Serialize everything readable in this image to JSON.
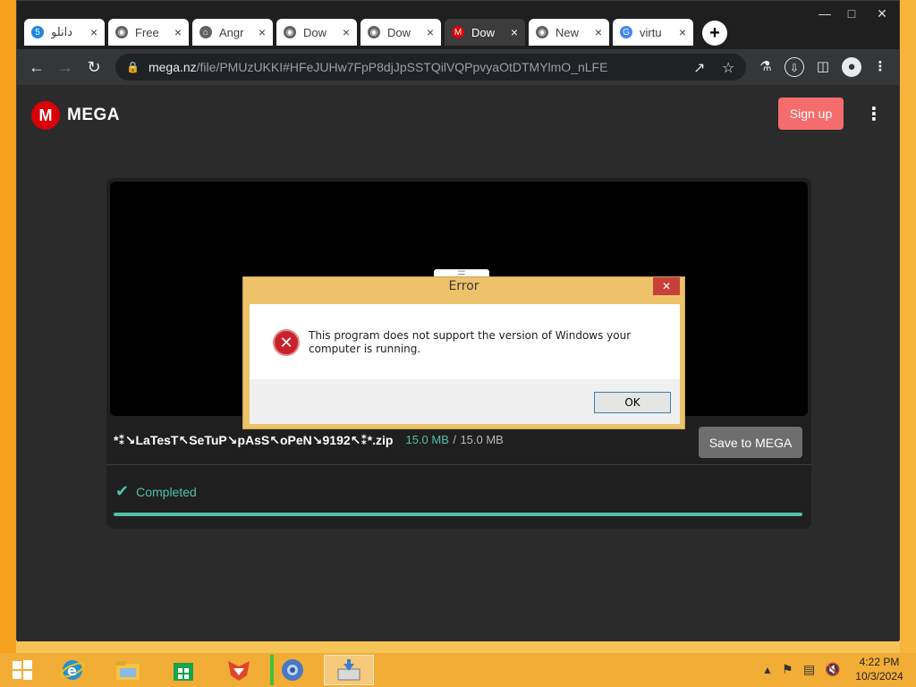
{
  "browser": {
    "tabs": [
      {
        "label": "دانلو",
        "icon": "5-site-icon",
        "icon_color": "#1e88e5"
      },
      {
        "label": "Free",
        "icon": "globe-icon",
        "icon_color": "#5f6368"
      },
      {
        "label": "Angr",
        "icon": "bank-icon",
        "icon_color": "#5f6368"
      },
      {
        "label": "Dow",
        "icon": "globe-icon",
        "icon_color": "#5f6368"
      },
      {
        "label": "Dow",
        "icon": "globe-icon",
        "icon_color": "#5f6368"
      },
      {
        "label": "Dow",
        "icon": "mega-icon",
        "icon_color": "#d90007",
        "active": true
      },
      {
        "label": "New",
        "icon": "chrome-icon",
        "icon_color": "#5f6368"
      },
      {
        "label": "virtu",
        "icon": "google-icon",
        "icon_color": "#4285f4"
      }
    ],
    "close_glyph": "×",
    "new_tab_glyph": "+",
    "url_host": "mega.nz",
    "url_path": "/file/PMUzUKKI#HFeJUHw7FpP8djJpSSTQilVQPpvyaOtDTMYlmO_nLFE"
  },
  "page": {
    "logo_letter": "M",
    "logo_word": "MEGA",
    "signup_label": "Sign up",
    "file_name": "*⁑↘LaTesT↖SeTuP↘pAsS↖oPeN↘9192↖⁑*.zip",
    "size_done": "15.0 MB",
    "size_sep": "/",
    "size_total": "15.0 MB",
    "save_label": "Save to MEGA",
    "status": "Completed",
    "progress_percent": 100
  },
  "dialog": {
    "title": "Error",
    "message": "This program does not support the version of Windows your computer is running.",
    "ok_label": "OK"
  },
  "taskbar": {
    "time": "4:22 PM",
    "date": "10/3/2024"
  }
}
